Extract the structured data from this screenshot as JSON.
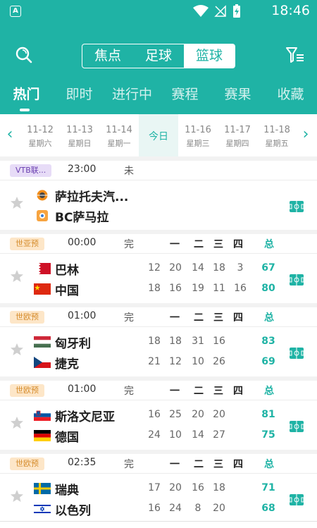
{
  "status_bar": {
    "app_badge": "A",
    "time": "18:46"
  },
  "sport_switch": [
    {
      "label": "焦点",
      "active": false
    },
    {
      "label": "足球",
      "active": false
    },
    {
      "label": "篮球",
      "active": true
    }
  ],
  "tabs": [
    {
      "label": "热门",
      "active": true
    },
    {
      "label": "即时",
      "active": false
    },
    {
      "label": "进行中",
      "active": false
    },
    {
      "label": "赛程",
      "active": false
    },
    {
      "label": "赛果",
      "active": false
    },
    {
      "label": "收藏",
      "active": false
    }
  ],
  "dates": [
    {
      "date": "11-12",
      "weekday": "星期六"
    },
    {
      "date": "11-13",
      "weekday": "星期日"
    },
    {
      "date": "11-14",
      "weekday": "星期一"
    },
    {
      "date": "今日",
      "weekday": "",
      "today": true
    },
    {
      "date": "11-16",
      "weekday": "星期三"
    },
    {
      "date": "11-17",
      "weekday": "星期四"
    },
    {
      "date": "11-18",
      "weekday": "星期五"
    }
  ],
  "quarter_headers": [
    "一",
    "二",
    "三",
    "四",
    "总"
  ],
  "matches": [
    {
      "league": "VTB联...",
      "league_color": "purple",
      "time": "23:00",
      "status": "未",
      "show_quarters": false,
      "home": {
        "name": "萨拉托夫汽...",
        "flag": "club-a"
      },
      "away": {
        "name": "BC萨马拉",
        "flag": "club-b"
      }
    },
    {
      "league": "世亚预",
      "league_color": "orange",
      "time": "00:00",
      "status": "完",
      "show_quarters": true,
      "home": {
        "name": "巴林",
        "flag": "bahrain",
        "scores": [
          "12",
          "20",
          "14",
          "18",
          "3"
        ],
        "total": "67"
      },
      "away": {
        "name": "中国",
        "flag": "china",
        "scores": [
          "18",
          "16",
          "19",
          "11",
          "16"
        ],
        "total": "80"
      }
    },
    {
      "league": "世欧预",
      "league_color": "orange",
      "time": "01:00",
      "status": "完",
      "show_quarters": true,
      "home": {
        "name": "匈牙利",
        "flag": "hungary",
        "scores": [
          "18",
          "18",
          "31",
          "16"
        ],
        "total": "83"
      },
      "away": {
        "name": "捷克",
        "flag": "czech",
        "scores": [
          "21",
          "12",
          "10",
          "26"
        ],
        "total": "69"
      }
    },
    {
      "league": "世欧预",
      "league_color": "orange",
      "time": "01:00",
      "status": "完",
      "show_quarters": true,
      "home": {
        "name": "斯洛文尼亚",
        "flag": "slovenia",
        "scores": [
          "16",
          "25",
          "20",
          "20"
        ],
        "total": "81"
      },
      "away": {
        "name": "德国",
        "flag": "germany",
        "scores": [
          "24",
          "10",
          "14",
          "27"
        ],
        "total": "75"
      }
    },
    {
      "league": "世欧预",
      "league_color": "orange",
      "time": "02:35",
      "status": "完",
      "show_quarters": true,
      "home": {
        "name": "瑞典",
        "flag": "sweden",
        "scores": [
          "17",
          "20",
          "16",
          "18"
        ],
        "total": "71"
      },
      "away": {
        "name": "以色列",
        "flag": "israel",
        "scores": [
          "16",
          "24",
          "8",
          "20"
        ],
        "total": "68"
      }
    }
  ],
  "colors": {
    "primary": "#1fb3a5",
    "league_purple_bg": "#e7dcf7",
    "league_orange_bg": "#fde6c8"
  }
}
